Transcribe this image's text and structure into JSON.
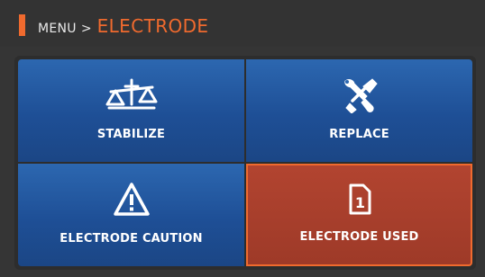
{
  "header": {
    "menu_label": "MENU",
    "separator": ">",
    "title": "ELECTRODE",
    "accent_color": "#f06a2e"
  },
  "tiles": [
    {
      "label": "STABILIZE",
      "icon": "balance-scale-icon",
      "selected": false
    },
    {
      "label": "REPLACE",
      "icon": "wrench-screwdriver-icon",
      "selected": false
    },
    {
      "label": "ELECTRODE CAUTION",
      "icon": "warning-triangle-icon",
      "selected": false
    },
    {
      "label": "ELECTRODE USED",
      "icon": "document-counter-icon",
      "icon_text": "1",
      "selected": true
    }
  ],
  "colors": {
    "tile_blue": "#1e4f96",
    "tile_selected": "#9e3a28",
    "background": "#353535"
  }
}
